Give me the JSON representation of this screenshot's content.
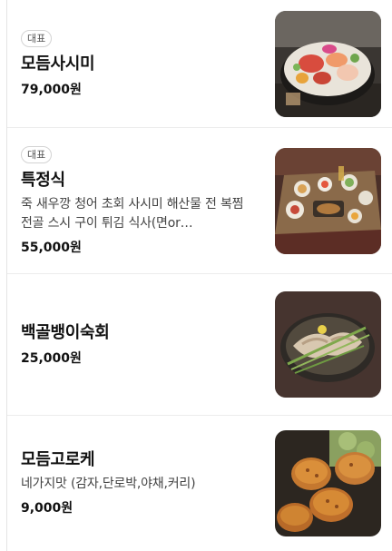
{
  "menu": {
    "items": [
      {
        "badge": "대표",
        "name": "모듬사시미",
        "description": "",
        "price": "79,000원",
        "image": "sashimi-platter-photo"
      },
      {
        "badge": "대표",
        "name": "특정식",
        "description": "죽 새우깡 청어 초회 사시미 해산물 전 복찜 전골 스시 구이 튀김 식사(면or…",
        "price": "55,000원",
        "image": "course-meal-table-photo"
      },
      {
        "badge": "",
        "name": "백골뱅이숙회",
        "description": "",
        "price": "25,000원",
        "image": "whelk-dish-photo"
      },
      {
        "badge": "",
        "name": "모듬고로케",
        "description": "네가지맛 (감자,단로박,야채,커리)",
        "price": "9,000원",
        "image": "croquette-plate-photo"
      }
    ]
  }
}
